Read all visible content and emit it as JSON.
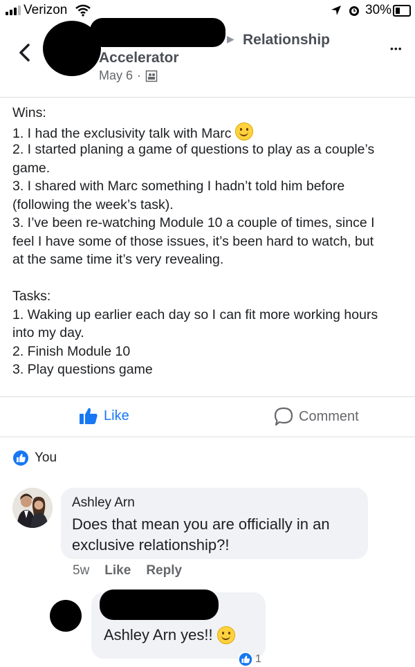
{
  "status_bar": {
    "carrier": "Verizon",
    "battery": "30%"
  },
  "header": {
    "group_arrow": "▶",
    "group_name": "Relationship",
    "author_line": "Accelerator",
    "date": "May 6",
    "separator": "·",
    "more": "•••"
  },
  "post": {
    "lines": [
      "Wins:",
      "1. I had the exclusivity talk with Marc",
      "2. I started planing a game of questions to play as a couple’s",
      "game.",
      "3. I shared with Marc something I hadn’t told him before",
      "(following the week’s task).",
      "3. I’ve been re-watching Module 10 a couple of times, since I",
      "feel I have some of those issues, it’s been hard to watch, but",
      "at the same time it’s very revealing.",
      "",
      "Tasks:",
      "1. Waking up earlier each day so I can fit more working hours",
      "into my day.",
      "2. Finish Module 10",
      "3. Play questions game"
    ]
  },
  "actions": {
    "like": "Like",
    "comment": "Comment"
  },
  "reactions": {
    "label": "You"
  },
  "comments": [
    {
      "author": "Ashley Arn",
      "text_line1": "Does that mean you are officially in an",
      "text_line2": "exclusive relationship?!",
      "time": "5w",
      "like": "Like",
      "reply": "Reply"
    },
    {
      "mention": "Ashley Arn",
      "text": "yes!!",
      "reaction_count": "1"
    }
  ],
  "colors": {
    "accent": "#1877f2",
    "meta": "#65676b",
    "bubble": "#f0f2f5"
  }
}
